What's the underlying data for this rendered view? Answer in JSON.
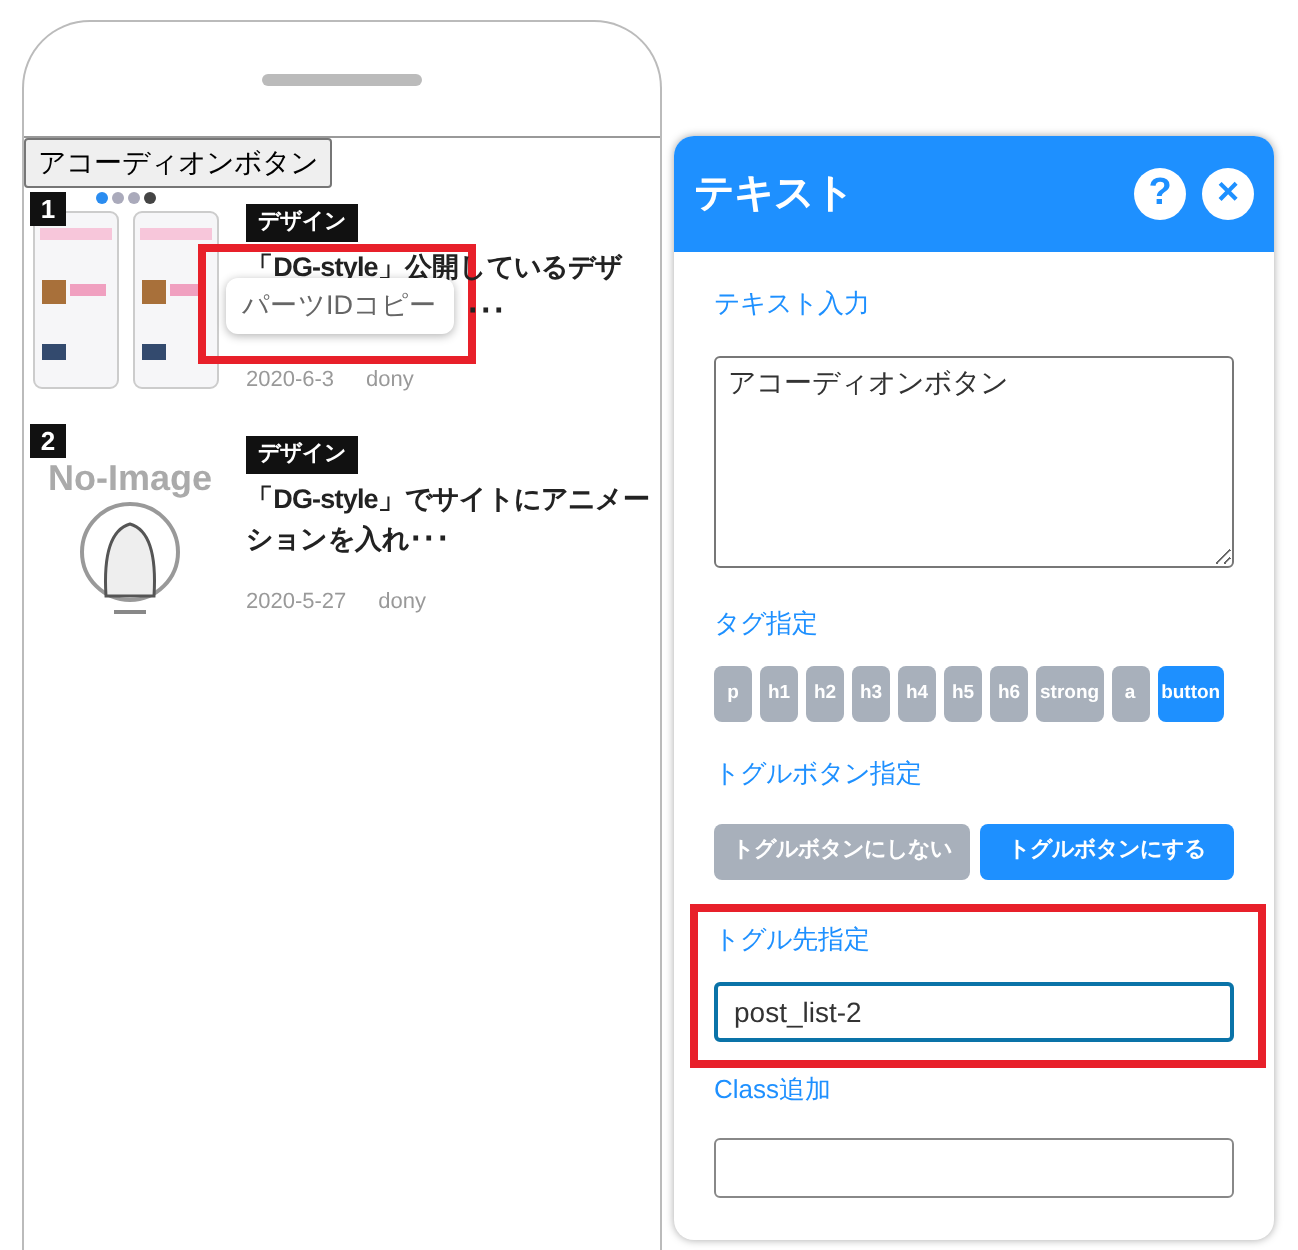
{
  "preview": {
    "accordion_button": "アコーディオンボタン",
    "posts": [
      {
        "rank": "1",
        "category": "デザイン",
        "title": "「DG-style」公開しているデザ",
        "title_tail": "･･･",
        "date": "2020-6-3",
        "author": "dony"
      },
      {
        "rank": "2",
        "category": "デザイン",
        "title": "「DG-style」でサイトにアニメーションを入れ･･･",
        "date": "2020-5-27",
        "author": "dony",
        "thumbnail": {
          "kind": "no-image",
          "text": "No-Image"
        }
      }
    ],
    "tooltip": "パーツIDコピー"
  },
  "panel": {
    "title": "テキスト",
    "help": "?",
    "close": "×",
    "text_label": "テキスト入力",
    "text_value": "アコーディオンボタン",
    "tag_label": "タグ指定",
    "tags": [
      {
        "label": "p",
        "selected": false
      },
      {
        "label": "h1",
        "selected": false
      },
      {
        "label": "h2",
        "selected": false
      },
      {
        "label": "h3",
        "selected": false
      },
      {
        "label": "h4",
        "selected": false
      },
      {
        "label": "h5",
        "selected": false
      },
      {
        "label": "h6",
        "selected": false
      },
      {
        "label": "strong",
        "selected": false
      },
      {
        "label": "a",
        "selected": false
      },
      {
        "label": "button",
        "selected": true
      }
    ],
    "toggle_label": "トグルボタン指定",
    "toggle_options": [
      {
        "label": "トグルボタンにしない",
        "selected": false
      },
      {
        "label": "トグルボタンにする",
        "selected": true
      }
    ],
    "target_label": "トグル先指定",
    "target_value": "post_list-2",
    "target_focused": true,
    "class_label": "Class追加"
  }
}
